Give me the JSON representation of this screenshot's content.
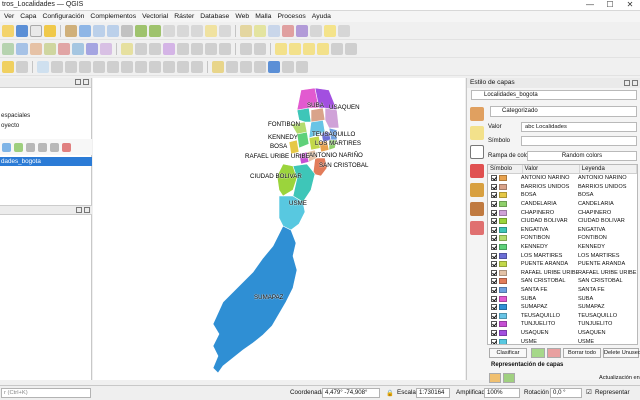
{
  "window": {
    "title": "tros_Localidades — QGIS",
    "min": "—",
    "max": "☐",
    "close": "✕"
  },
  "menu": [
    "Ver",
    "Capa",
    "Configuración",
    "Complementos",
    "Vectorial",
    "Ráster",
    "Database",
    "Web",
    "Malla",
    "Procesos",
    "Ayuda"
  ],
  "browser_panel": {
    "items": [
      "espaciales",
      "oyecto",
      ")"
    ]
  },
  "layers_panel": {
    "selected_layer": "dades_bogota"
  },
  "map": {
    "labels": [
      "SUBA",
      "USAQUEN",
      "FONTIBON",
      "TEUSAQUILLO",
      "KENNEDY",
      "LOS MARTIRES",
      "BOSA",
      "ANTONIO NARIÑO",
      "RAFAEL URIBE URIBE",
      "SAN CRISTOBAL",
      "CIUDAD BOLIVAR",
      "USME",
      "SUMAPAZ"
    ]
  },
  "style_panel": {
    "title": "Estilo de capas",
    "layer": "Localidades_bogota",
    "renderer": "Categorizado",
    "value_label": "Valor",
    "value": "abc Localidades",
    "symbol_label": "Símbolo",
    "ramp_label": "Rampa de color",
    "ramp_value": "Random colors",
    "col_symbol": "Símbolo",
    "col_value": "Valor",
    "col_legend": "Leyenda",
    "categories": [
      {
        "value": "ANTONIO NARIÑO",
        "legend": "ANTONIO NARIÑO",
        "color": "#e8a24e"
      },
      {
        "value": "BARRIOS UNIDOS",
        "legend": "BARRIOS UNIDOS",
        "color": "#d9a38a"
      },
      {
        "value": "BOSA",
        "legend": "BOSA",
        "color": "#e6c846"
      },
      {
        "value": "CANDELARIA",
        "legend": "CANDELARIA",
        "color": "#8fd06b"
      },
      {
        "value": "CHAPINERO",
        "legend": "CHAPINERO",
        "color": "#d0a2d8"
      },
      {
        "value": "CIUDAD BOLIVAR",
        "legend": "CIUDAD BOLIVAR",
        "color": "#9bd43c"
      },
      {
        "value": "ENGATIVA",
        "legend": "ENGATIVA",
        "color": "#3ec6b8"
      },
      {
        "value": "FONTIBON",
        "legend": "FONTIBON",
        "color": "#b3dc6e"
      },
      {
        "value": "KENNEDY",
        "legend": "KENNEDY",
        "color": "#5fd17a"
      },
      {
        "value": "LOS MARTIRES",
        "legend": "LOS MARTIRES",
        "color": "#6c6fd6"
      },
      {
        "value": "PUENTE ARANDA",
        "legend": "PUENTE ARANDA",
        "color": "#c2d84a"
      },
      {
        "value": "RAFAEL URIBE URIBE",
        "legend": "RAFAEL URIBE URIBE",
        "color": "#e3c2a6"
      },
      {
        "value": "SAN CRISTOBAL",
        "legend": "SAN CRISTOBAL",
        "color": "#e27c5a"
      },
      {
        "value": "SANTA FE",
        "legend": "SANTA FE",
        "color": "#6ea0e0"
      },
      {
        "value": "SUBA",
        "legend": "SUBA",
        "color": "#e25ad0"
      },
      {
        "value": "SUMAPAZ",
        "legend": "SUMAPAZ",
        "color": "#2f8fd4"
      },
      {
        "value": "TEUSAQUILLO",
        "legend": "TEUSAQUILLO",
        "color": "#68c4e6"
      },
      {
        "value": "TUNJUELITO",
        "legend": "TUNJUELITO",
        "color": "#c64fd4"
      },
      {
        "value": "USAQUEN",
        "legend": "USAQUEN",
        "color": "#a24fe0"
      },
      {
        "value": "USME",
        "legend": "USME",
        "color": "#58c8e0"
      }
    ],
    "btn_classify": "Clasificar",
    "btn_remove_all": "Borrar todo",
    "btn_delete_unused": "Delete Unused",
    "section_render": "Representación de capas",
    "live_update": "Actualización en",
    "apply": "Aplicar"
  },
  "status": {
    "locator_placeholder": "r (Ctrl+K)",
    "coord_label": "Coordenada",
    "coord_value": "4,479°  -74,908°",
    "scale_label": "Escala",
    "scale_value": "1:730164",
    "mag_label": "Amplificador",
    "mag_value": "100%",
    "rot_label": "Rotación",
    "rot_value": "0,0 °",
    "render_label": "Representar"
  }
}
